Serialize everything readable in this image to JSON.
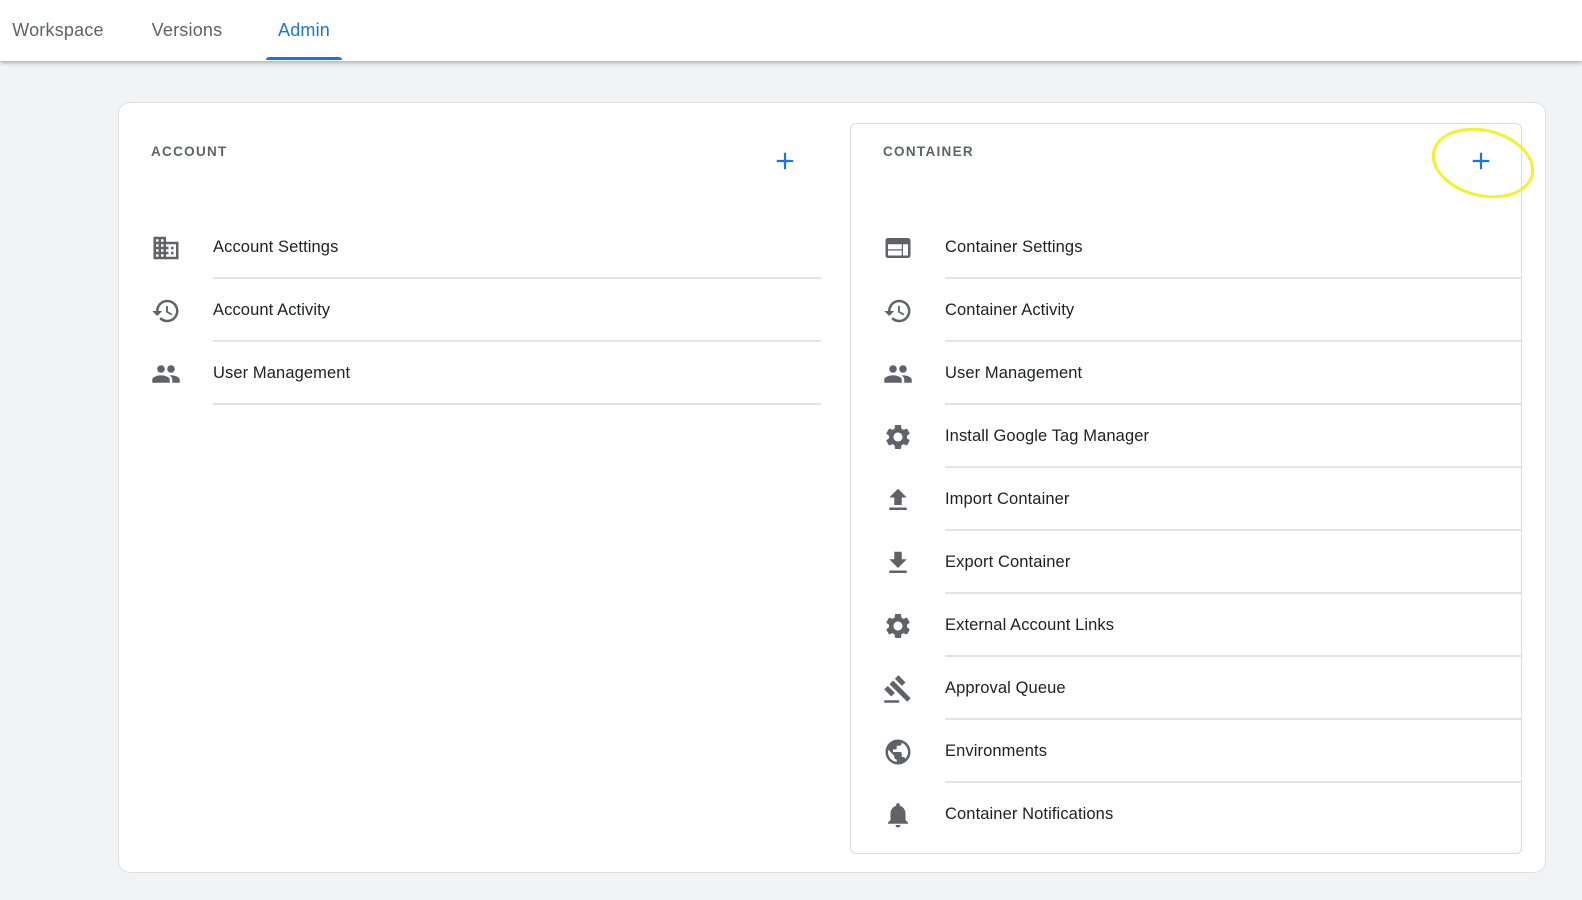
{
  "nav": {
    "tabs": [
      {
        "label": "Workspace",
        "active": false
      },
      {
        "label": "Versions",
        "active": false
      },
      {
        "label": "Admin",
        "active": true
      }
    ]
  },
  "colors": {
    "accent": "#1a73e8",
    "icon": "#5f6368",
    "highlight": "#f2f22a",
    "background": "#f1f3f4"
  },
  "account": {
    "title": "ACCOUNT",
    "add_icon": "plus-icon",
    "items": [
      {
        "label": "Account Settings",
        "icon": "building-icon"
      },
      {
        "label": "Account Activity",
        "icon": "history-icon"
      },
      {
        "label": "User Management",
        "icon": "people-icon"
      }
    ]
  },
  "container": {
    "title": "CONTAINER",
    "add_icon": "plus-icon",
    "add_highlighted": true,
    "items": [
      {
        "label": "Container Settings",
        "icon": "web-layout-icon"
      },
      {
        "label": "Container Activity",
        "icon": "history-icon"
      },
      {
        "label": "User Management",
        "icon": "people-icon"
      },
      {
        "label": "Install Google Tag Manager",
        "icon": "gear-icon"
      },
      {
        "label": "Import Container",
        "icon": "upload-icon"
      },
      {
        "label": "Export Container",
        "icon": "download-icon"
      },
      {
        "label": "External Account Links",
        "icon": "gear-icon"
      },
      {
        "label": "Approval Queue",
        "icon": "gavel-icon"
      },
      {
        "label": "Environments",
        "icon": "globe-icon"
      },
      {
        "label": "Container Notifications",
        "icon": "bell-icon"
      }
    ]
  }
}
